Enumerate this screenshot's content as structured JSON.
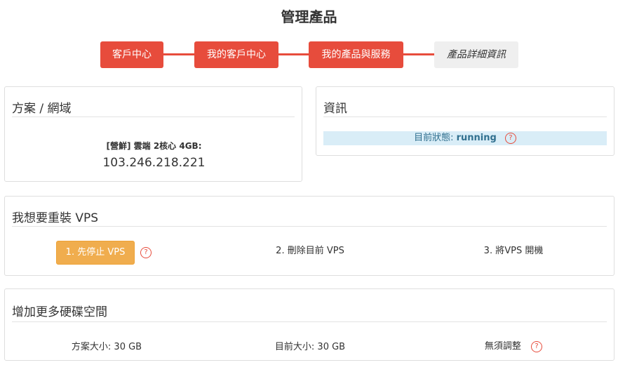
{
  "page": {
    "title": "管理產品"
  },
  "breadcrumb": {
    "steps": [
      "客戶中心",
      "我的客戶中心",
      "我的產品與服務",
      "產品詳細資訊"
    ]
  },
  "plan_panel": {
    "title": "方案 / 網域",
    "product_name": "[營鮮] 雲端 2核心 4GB:",
    "ip": "103.246.218.221"
  },
  "info_panel": {
    "title": "資訊",
    "status_label": "目前狀態:",
    "status_value": "running"
  },
  "reinstall_panel": {
    "title": "我想要重裝 VPS",
    "step1_button": "1. 先停止 VPS",
    "step2": "2. 刪除目前 VPS",
    "step3": "3. 將VPS 開機"
  },
  "disk_panel": {
    "title": "增加更多硬碟空間",
    "plan_size": "方案大小: 30 GB",
    "current_size": "目前大小: 30 GB",
    "adjust": "無須調整"
  },
  "icons": {
    "help": "?"
  },
  "colors": {
    "accent": "#e74c3c",
    "warning": "#f0ad4e",
    "info_bg": "#d9edf7",
    "info_text": "#31708f"
  }
}
